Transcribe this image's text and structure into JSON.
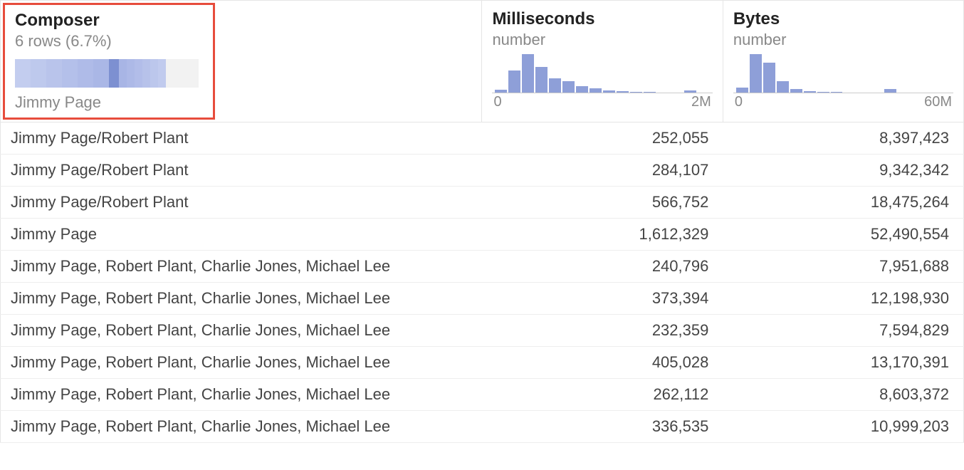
{
  "columns": {
    "composer": {
      "title": "Composer",
      "subtitle": "6 rows (6.7%)",
      "filter_label": "Jimmy Page",
      "segments": [
        {
          "width": 22,
          "color": "#c3cdef"
        },
        {
          "width": 22,
          "color": "#bec9ed"
        },
        {
          "width": 22,
          "color": "#b9c4eb"
        },
        {
          "width": 22,
          "color": "#b4c0ea"
        },
        {
          "width": 22,
          "color": "#afbbe8"
        },
        {
          "width": 22,
          "color": "#aab7e6"
        },
        {
          "width": 14,
          "color": "#7d90d1"
        },
        {
          "width": 11,
          "color": "#a8b5e5"
        },
        {
          "width": 11,
          "color": "#adb9e7"
        },
        {
          "width": 11,
          "color": "#b2bde9"
        },
        {
          "width": 11,
          "color": "#b7c2ea"
        },
        {
          "width": 11,
          "color": "#bcc7ec"
        },
        {
          "width": 11,
          "color": "#c1cbee"
        },
        {
          "width": 46,
          "color": "#f2f2f2"
        }
      ]
    },
    "milliseconds": {
      "title": "Milliseconds",
      "subtitle": "number",
      "axis_min": "0",
      "axis_max": "2M",
      "histogram": [
        4,
        28,
        48,
        32,
        18,
        14,
        8,
        5,
        3,
        2,
        1,
        1,
        0,
        0,
        3,
        0
      ]
    },
    "bytes": {
      "title": "Bytes",
      "subtitle": "number",
      "axis_min": "0",
      "axis_max": "60M",
      "histogram": [
        6,
        46,
        36,
        14,
        4,
        2,
        1,
        1,
        0,
        0,
        0,
        4,
        0,
        0,
        0,
        0
      ]
    }
  },
  "rows": [
    {
      "composer": "Jimmy Page/Robert Plant",
      "ms": "252,055",
      "bytes": "8,397,423"
    },
    {
      "composer": "Jimmy Page/Robert Plant",
      "ms": "284,107",
      "bytes": "9,342,342"
    },
    {
      "composer": "Jimmy Page/Robert Plant",
      "ms": "566,752",
      "bytes": "18,475,264"
    },
    {
      "composer": "Jimmy Page",
      "ms": "1,612,329",
      "bytes": "52,490,554"
    },
    {
      "composer": "Jimmy Page, Robert Plant, Charlie Jones, Michael Lee",
      "ms": "240,796",
      "bytes": "7,951,688"
    },
    {
      "composer": "Jimmy Page, Robert Plant, Charlie Jones, Michael Lee",
      "ms": "373,394",
      "bytes": "12,198,930"
    },
    {
      "composer": "Jimmy Page, Robert Plant, Charlie Jones, Michael Lee",
      "ms": "232,359",
      "bytes": "7,594,829"
    },
    {
      "composer": "Jimmy Page, Robert Plant, Charlie Jones, Michael Lee",
      "ms": "405,028",
      "bytes": "13,170,391"
    },
    {
      "composer": "Jimmy Page, Robert Plant, Charlie Jones, Michael Lee",
      "ms": "262,112",
      "bytes": "8,603,372"
    },
    {
      "composer": "Jimmy Page, Robert Plant, Charlie Jones, Michael Lee",
      "ms": "336,535",
      "bytes": "10,999,203"
    }
  ],
  "chart_data": [
    {
      "type": "bar",
      "title": "Milliseconds distribution",
      "xlabel": "",
      "ylabel": "",
      "xlim": [
        0,
        2000000
      ],
      "categories_note": "bins across 0 to 2M",
      "values": [
        4,
        28,
        48,
        32,
        18,
        14,
        8,
        5,
        3,
        2,
        1,
        1,
        0,
        0,
        3,
        0
      ]
    },
    {
      "type": "bar",
      "title": "Bytes distribution",
      "xlabel": "",
      "ylabel": "",
      "xlim": [
        0,
        60000000
      ],
      "categories_note": "bins across 0 to 60M",
      "values": [
        6,
        46,
        36,
        14,
        4,
        2,
        1,
        1,
        0,
        0,
        0,
        4,
        0,
        0,
        0,
        0
      ]
    }
  ]
}
